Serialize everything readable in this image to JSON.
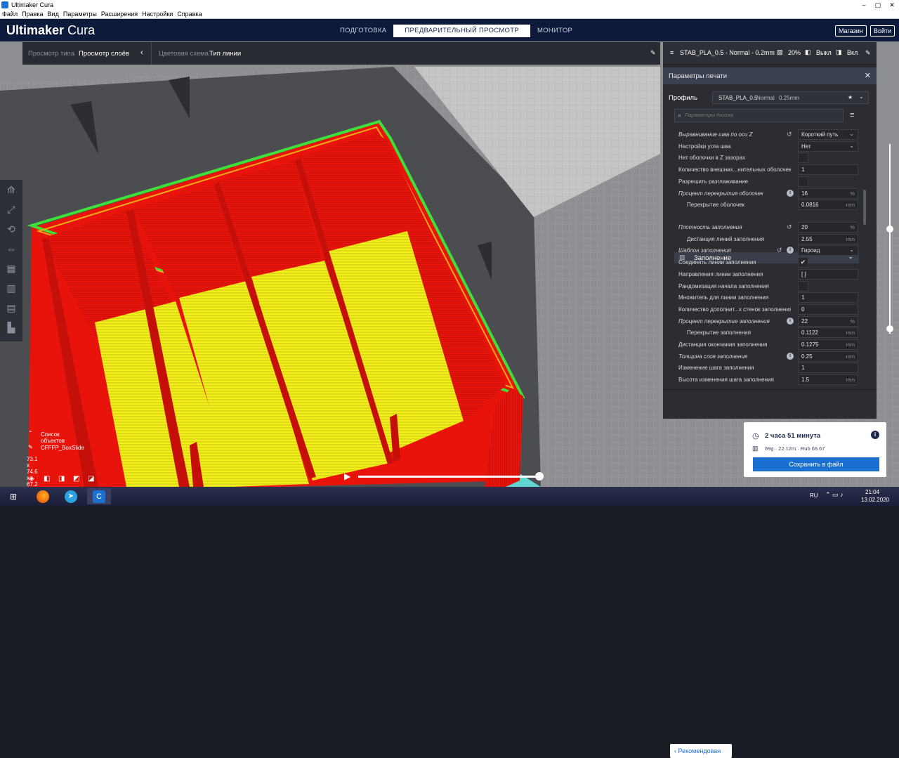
{
  "window": {
    "title": "Ultimaker Cura"
  },
  "menu": [
    "Файл",
    "Правка",
    "Вид",
    "Параметры",
    "Расширения",
    "Настройки",
    "Справка"
  ],
  "header": {
    "logo_bold": "Ultimaker",
    "logo_light": "Cura",
    "tabs": [
      "ПОДГОТОВКА",
      "ПРЕДВАРИТЕЛЬНЫЙ ПРОСМОТР",
      "МОНИТОР"
    ],
    "active_tab": "ПРЕДВАРИТЕЛЬНЫЙ ПРОСМОТР",
    "shop_button": "Магазин",
    "login_button": "Войти"
  },
  "viewbar": {
    "view_type_label": "Просмотр типа",
    "view_type_value": "Просмотр слоёв",
    "color_scheme_label": "Цветовая схема",
    "color_scheme_value": "Тип линии"
  },
  "profile_bar": {
    "profile": "STAB_PLA_0.5 - Normal - 0.2mm",
    "infill": "20%",
    "support": "Выкл",
    "adhesion": "Вкл"
  },
  "settings_panel": {
    "title": "Параметры печати",
    "profile_label": "Профиль",
    "profile_name": "STAB_PLA_0.5",
    "profile_quality": "Normal",
    "profile_layer": "0.25mm",
    "search_placeholder": "Параметры поиска",
    "section_name": "Заполнение",
    "recommended_button": "Рекомендован"
  },
  "settings_rows_top": [
    {
      "name": "Выравнивание шва по оси Z",
      "value": "Короткий путь",
      "type": "dropdown",
      "reset": true
    },
    {
      "name": "Настройки угла шва",
      "value": "Нет",
      "type": "dropdown"
    },
    {
      "name": "Нет оболочки в Z зазорах",
      "type": "checkbox",
      "checked": false
    },
    {
      "name": "Количество внешних...нительных оболочек",
      "value": "1",
      "type": "input"
    },
    {
      "name": "Разрешить разглаживание",
      "type": "checkbox",
      "checked": false
    },
    {
      "name": "Процент перекрытия оболочек",
      "value": "16",
      "unit": "%",
      "type": "input",
      "info": true
    },
    {
      "name": "Перекрытие оболочек",
      "value": "0.0816",
      "unit": "mm",
      "type": "input",
      "indent": true
    }
  ],
  "settings_rows_infill": [
    {
      "name": "Плотность заполнения",
      "value": "20",
      "unit": "%",
      "type": "input",
      "reset": true
    },
    {
      "name": "Дистанция линий заполнения",
      "value": "2.55",
      "unit": "mm",
      "type": "input",
      "indent": true
    },
    {
      "name": "Шаблон заполнения",
      "value": "Гироид",
      "type": "dropdown",
      "reset": true,
      "info": true
    },
    {
      "name": "Соединять линии заполнения",
      "type": "checkbox",
      "checked": true
    },
    {
      "name": "Направления линии заполнения",
      "value": "[ ]",
      "type": "input"
    },
    {
      "name": "Рандомизация начала заполнения",
      "type": "checkbox",
      "checked": false
    },
    {
      "name": "Множитель для линии заполнения",
      "value": "1",
      "type": "input"
    },
    {
      "name": "Количество дополнит...х стенок заполнения",
      "value": "0",
      "type": "input"
    },
    {
      "name": "Процент перекрытие заполнения",
      "value": "22",
      "unit": "%",
      "type": "input",
      "info": true
    },
    {
      "name": "Перекрытие заполнения",
      "value": "0.1122",
      "unit": "mm",
      "type": "input",
      "indent": true
    },
    {
      "name": "Дистанция окончания заполнения",
      "value": "0.1275",
      "unit": "mm",
      "type": "input"
    },
    {
      "name": "Толщина слоя заполнения",
      "value": "0.25",
      "unit": "mm",
      "type": "input",
      "info": true
    },
    {
      "name": "Изменение шага заполнения",
      "value": "1",
      "type": "input"
    },
    {
      "name": "Высота изменения шага заполнения",
      "value": "1.5",
      "unit": "mm",
      "type": "input"
    }
  ],
  "object_list": {
    "label": "Список объектов",
    "name": "CFFFP_BoxSlide",
    "dimensions": "73.1 x 74.6 x 67.2 mm"
  },
  "estimate": {
    "time": "2 часа 51 минута",
    "material": "69g · 22.12m · Rub 66.67",
    "save_button": "Сохранить в файл"
  },
  "layer_slider": {
    "position_fraction": 0.55
  },
  "playback": {
    "position_fraction": 1.0
  },
  "taskbar": {
    "lang": "RU",
    "time": "21:04",
    "date": "13.02.2020"
  },
  "colors": {
    "header": "#0d1a3a",
    "panel": "#2b2d33",
    "accent": "#1b6fd1",
    "wall_red": "#e8140c",
    "infill_yellow": "#f3f019",
    "skirt_green": "#3ee03a"
  }
}
